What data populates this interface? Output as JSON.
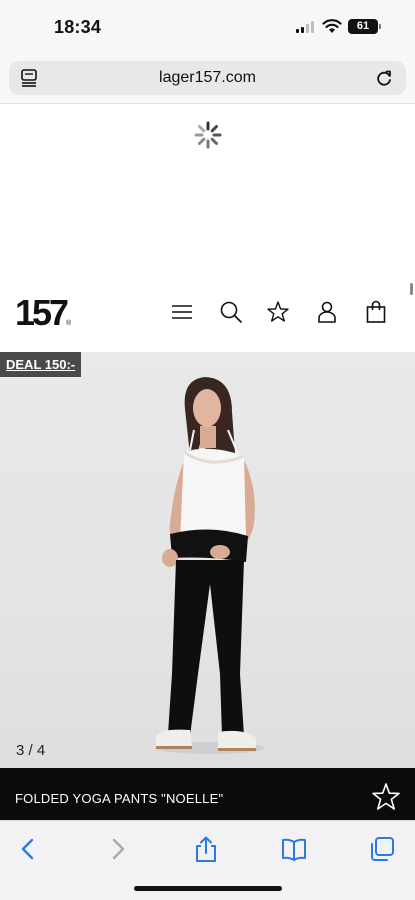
{
  "status_bar": {
    "time": "18:34",
    "battery": "61"
  },
  "browser": {
    "url": "lager157.com"
  },
  "site": {
    "logo": "157",
    "logo_mark": "®",
    "nav_icons": [
      "menu-icon",
      "search-icon",
      "star-icon",
      "user-icon",
      "bag-icon"
    ]
  },
  "product": {
    "deal_badge": "DEAL 150:-",
    "image_counter": "3 / 4",
    "title": "FOLDED YOGA PANTS \"NOELLE\""
  },
  "toolbar": {
    "icons": [
      "back-icon",
      "forward-icon",
      "share-icon",
      "bookmarks-icon",
      "tabs-icon"
    ],
    "accent": "#2a7ae2",
    "disabled": "#a9a9ad"
  }
}
